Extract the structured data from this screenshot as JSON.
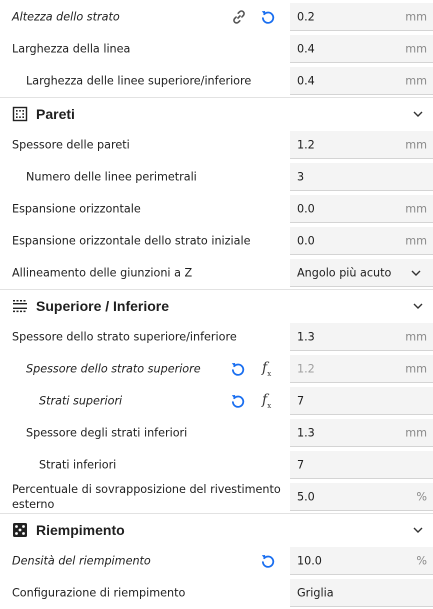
{
  "rows": {
    "layer_height": {
      "label": "Altezza dello strato",
      "value": "0.2",
      "unit": "mm"
    },
    "line_width": {
      "label": "Larghezza della linea",
      "value": "0.4",
      "unit": "mm"
    },
    "top_bottom_line_width": {
      "label": "Larghezza delle linee superiore/inferiore",
      "value": "0.4",
      "unit": "mm"
    },
    "wall_thickness": {
      "label": "Spessore delle pareti",
      "value": "1.2",
      "unit": "mm"
    },
    "wall_line_count": {
      "label": "Numero delle linee perimetrali",
      "value": "3"
    },
    "horizontal_expansion": {
      "label": "Espansione orizzontale",
      "value": "0.0",
      "unit": "mm"
    },
    "initial_layer_expansion": {
      "label": "Espansione orizzontale dello strato iniziale",
      "value": "0.0",
      "unit": "mm"
    },
    "z_seam_alignment": {
      "label": "Allineamento delle giunzioni a Z",
      "value": "Angolo più acuto"
    },
    "top_bottom_thickness": {
      "label": "Spessore dello strato superiore/inferiore",
      "value": "1.3",
      "unit": "mm"
    },
    "top_thickness": {
      "label": "Spessore dello strato superiore",
      "value": "1.2",
      "unit": "mm"
    },
    "top_layers": {
      "label": "Strati superiori",
      "value": "7"
    },
    "bottom_thickness": {
      "label": "Spessore degli strati inferiori",
      "value": "1.3",
      "unit": "mm"
    },
    "bottom_layers": {
      "label": "Strati inferiori",
      "value": "7"
    },
    "skin_overlap": {
      "label_line1": "Percentuale di sovrapposizione del rivestimento",
      "label_line2": "esterno",
      "value": "5.0",
      "unit": "%"
    },
    "infill_density": {
      "label": "Densità del riempimento",
      "value": "10.0",
      "unit": "%"
    },
    "infill_pattern": {
      "label": "Configurazione di riempimento",
      "value": "Griglia"
    }
  },
  "sections": {
    "walls": {
      "title": "Pareti",
      "icon": "walls-icon"
    },
    "top_bottom": {
      "title": "Superiore / Inferiore",
      "icon": "top-bottom-icon"
    },
    "infill": {
      "title": "Riempimento",
      "icon": "infill-icon"
    }
  },
  "icons": {
    "link": "link-icon",
    "reset": "reset-icon",
    "function": "function-icon",
    "chevron": "chevron-down-icon"
  },
  "colors": {
    "accent": "#196ef0",
    "field_bg": "#f4f4f4",
    "unit": "#8a8a8a"
  }
}
